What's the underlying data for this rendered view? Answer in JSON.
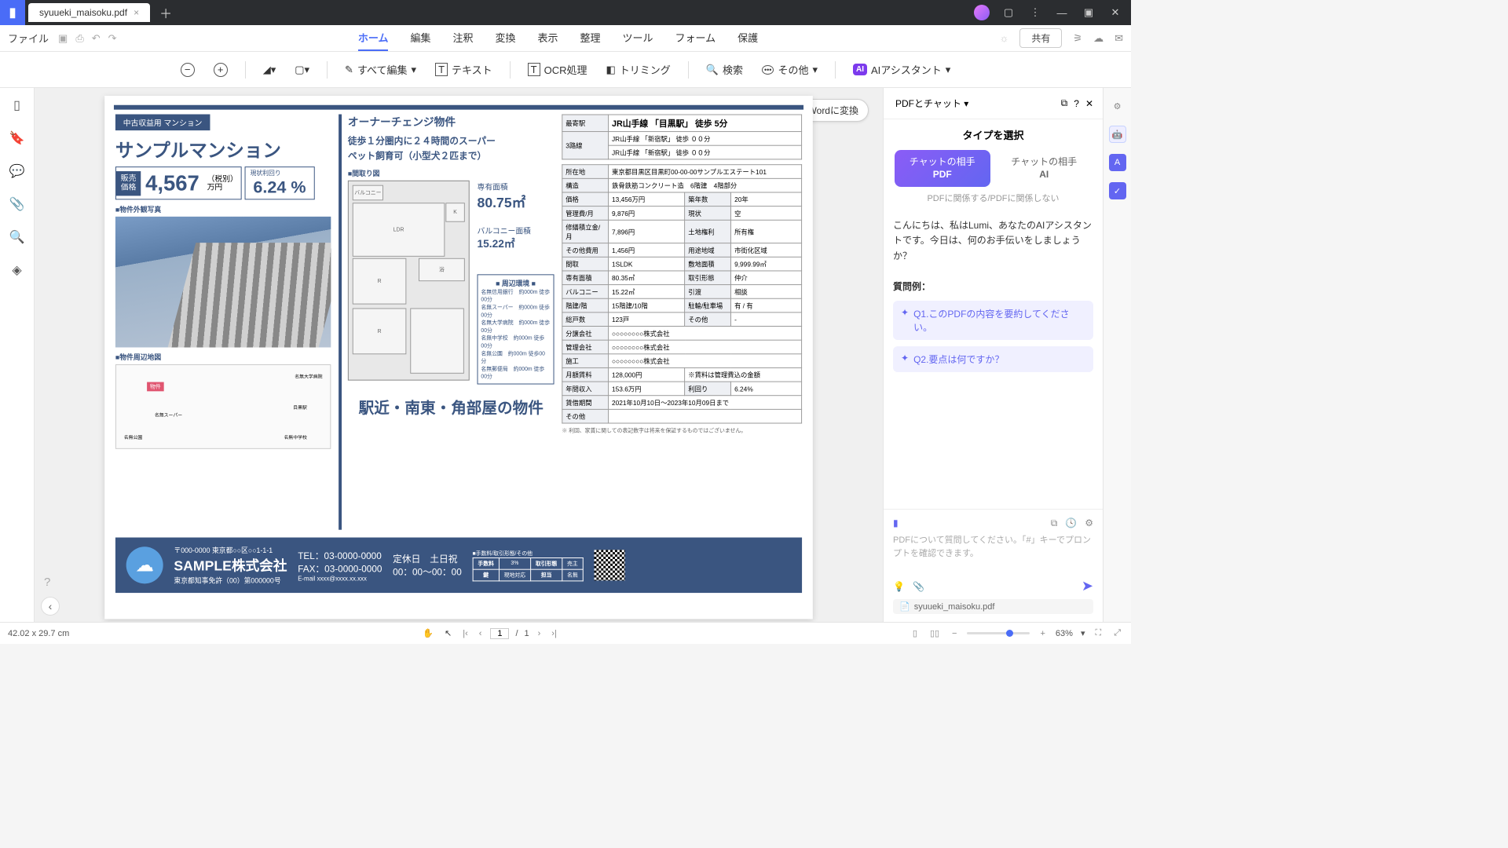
{
  "titlebar": {
    "filename": "syuueki_maisoku.pdf"
  },
  "menubar": {
    "file": "ファイル",
    "tabs": [
      "ホーム",
      "編集",
      "注釈",
      "変換",
      "表示",
      "整理",
      "ツール",
      "フォーム",
      "保護"
    ],
    "share": "共有"
  },
  "toolbar": {
    "edit_all": "すべて編集",
    "text": "テキスト",
    "ocr": "OCR処理",
    "trim": "トリミング",
    "search": "検索",
    "other": "その他",
    "ai": "AIアシスタント"
  },
  "word_button": "PDFをWordに変換",
  "right_panel": {
    "selector": "PDFとチャット",
    "title": "タイプを選択",
    "mode1_l1": "チャットの相手",
    "mode1_l2": "PDF",
    "mode2_l1": "チャットの相手",
    "mode2_l2": "AI",
    "sub": "PDFに関係する/PDFに関係しない",
    "greeting": "こんにちは、私はLumi、あなたのAIアシスタントです。今日は、何のお手伝いをしましょうか？",
    "examples_title": "質問例：",
    "q1": "Q1.このPDFの内容を要約してください。",
    "q2": "Q2.要点は何ですか？",
    "placeholder": "PDFについて質問してください。「#」キーでプロンプトを確認できます。",
    "attachment": "syuueki_maisoku.pdf"
  },
  "statusbar": {
    "dims": "42.02 x 29.7 cm",
    "page": "1",
    "total": "1",
    "zoom": "63%"
  },
  "doc": {
    "tag": "中古収益用 マンション",
    "name": "サンプルマンション",
    "price_label": "販売\n価格",
    "price": "4,567",
    "price_unit": "（税別）\n万円",
    "yield_label": "現状利回り",
    "yield": "6.24 %",
    "photo_label": "■物件外観写真",
    "map_label": "■物件周辺地図",
    "map_marker": "物件",
    "headline": "オーナーチェンジ物件",
    "lines": "徒歩１分圏内に２４時間のスーパー\nペット飼育可（小型犬２匹まで）",
    "plan_label": "■間取り図",
    "area_label": "専有面積",
    "area": "80.75㎡",
    "balcony_label": "バルコニー面積",
    "balcony": "15.22㎡",
    "env_title": "■ 周辺環境 ■",
    "env_items": [
      "名無信用銀行",
      "名無スーパー",
      "名無大学病院",
      "名無中学校",
      "名無公園",
      "名無郵便局"
    ],
    "catch": "駅近・南東・角部屋の物件",
    "station_label": "最寄駅",
    "station": "JR山手線 「目黒駅」 徒歩 5分",
    "lines3_label": "3路線",
    "line1": "JR山手線 「新宿駅」 徒歩 ００分",
    "line2": "JR山手線 「新宿駅」 徒歩 ００分",
    "rows": [
      [
        "所在地",
        "東京都目黒区目黒町00-00-00サンプルエステート101",
        "",
        ""
      ],
      [
        "構造",
        "鉄骨鉄筋コンクリート造　6階建　4階部分",
        "",
        ""
      ],
      [
        "価格",
        "13,456万円",
        "築年数",
        "20年"
      ],
      [
        "管理費/月",
        "9,876円",
        "現状",
        "空"
      ],
      [
        "修繕積立金/月",
        "7,896円",
        "土地権利",
        "所有権"
      ],
      [
        "その他費用",
        "1,456円",
        "用途地域",
        "市街化区域"
      ],
      [
        "間取",
        "1SLDK",
        "敷地面積",
        "9,999.99㎡"
      ],
      [
        "専有面積",
        "80.35㎡",
        "取引形態",
        "仲介"
      ],
      [
        "バルコニー",
        "15.22㎡",
        "引渡",
        "相談"
      ],
      [
        "階建/階",
        "15階建/10階",
        "駐輪/駐車場",
        "有 / 有"
      ],
      [
        "総戸数",
        "123戸",
        "その他",
        "-"
      ],
      [
        "分譲会社",
        "○○○○○○○○株式会社",
        "",
        ""
      ],
      [
        "管理会社",
        "○○○○○○○○株式会社",
        "",
        ""
      ],
      [
        "施工",
        "○○○○○○○○株式会社",
        "",
        ""
      ],
      [
        "月額賃料",
        "128,000円",
        "※賃料は管理費込の金額",
        ""
      ],
      [
        "年間収入",
        "153.6万円",
        "利回り",
        "6.24%"
      ],
      [
        "賃借期間",
        "2021年10月10日～2023年10月09日まで",
        "",
        ""
      ],
      [
        "その他",
        "",
        "",
        ""
      ]
    ],
    "note": "※ 利回、家賃に関しての表記数字は将来を保証するものではございません。",
    "footer": {
      "addr": "〒000-0000 東京都○○区○○1-1-1",
      "company": "SAMPLE株式会社",
      "license": "東京都知事免許（00）第000000号",
      "tel": "TEL：03-0000-0000",
      "fax": "FAX：03-0000-0000",
      "email": "E-mail xxxx@xxxx.xx.xxx",
      "holiday_l": "定休日",
      "holiday": "土日祝",
      "hours": "00：00～00：00",
      "fee_title": "■手数料/取引形態/その他",
      "fee_rows": [
        [
          "手数料",
          "3%",
          "取引形態",
          "売主"
        ],
        [
          "鍵",
          "現地対応",
          "担当",
          "名無"
        ]
      ]
    }
  }
}
